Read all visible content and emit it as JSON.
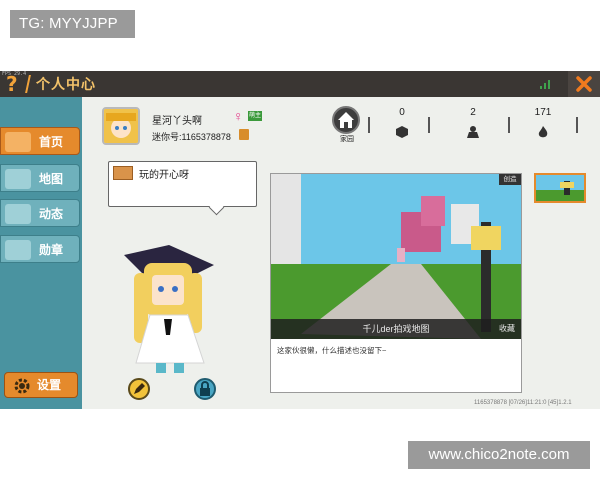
{
  "watermarks": {
    "top": "TG: MYYJJPP",
    "bottom": "www.chico2note.com"
  },
  "header": {
    "fps": "FPS 29.4",
    "title": "个人中心"
  },
  "sidebar": {
    "items": [
      {
        "label": "首页",
        "active": true
      },
      {
        "label": "地图",
        "active": false
      },
      {
        "label": "动态",
        "active": false
      },
      {
        "label": "勋章",
        "active": false
      }
    ],
    "settings_label": "设置"
  },
  "profile": {
    "username": "星河丫头啊",
    "level_badge": "萌主",
    "mini_id": "迷你号:1165378878"
  },
  "stats": {
    "home_label": "家园",
    "values": [
      "0",
      "2",
      "171"
    ]
  },
  "bubble": {
    "text": "玩的开心呀"
  },
  "showcase": {
    "tag": "创造",
    "caption": "千儿der拍戏地图",
    "favorite": "收藏",
    "description": "这家伙很懒，什么描述也没留下~"
  },
  "footer": {
    "info": "1165378878   [07/26]11:21:0   [45]1.2.1"
  },
  "colors": {
    "accent": "#e58a2c",
    "sidebar": "#4a93a0",
    "titlebar": "#3a3633"
  }
}
